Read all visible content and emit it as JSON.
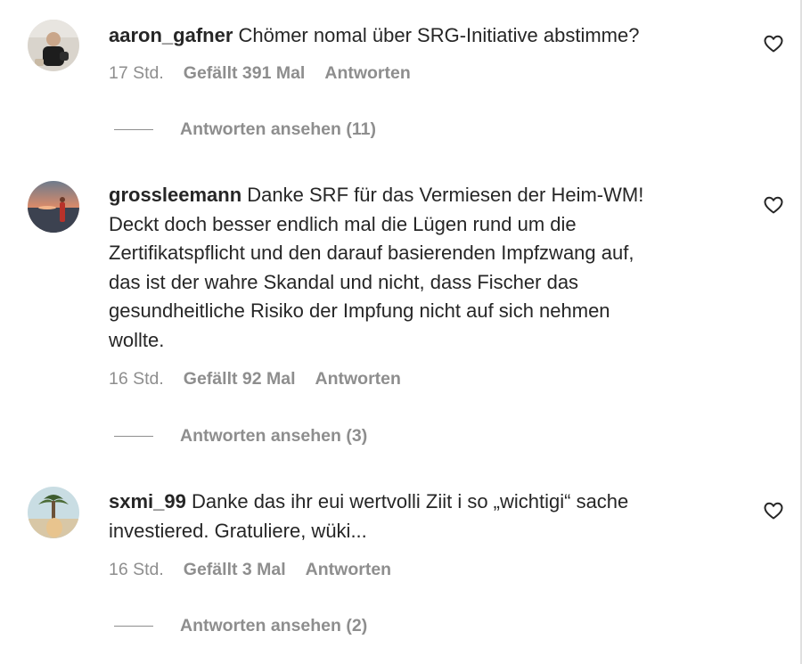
{
  "comments": [
    {
      "username": "aaron_gafner",
      "text": "Chömer nomal über SRG-Initiative abstimme?",
      "time": "17 Std.",
      "likes": "Gefällt 391 Mal",
      "reply": "Antworten",
      "view_replies": "Antworten ansehen (11)",
      "avatar": "avatar-person-dark-shirt"
    },
    {
      "username": "grossleemann",
      "text": "Danke SRF für das Vermiesen der Heim-WM!\nDeckt doch besser endlich mal die Lügen rund um die\nZertifikatspflicht und den darauf basierenden Impfzwang auf,\ndas ist der wahre Skandal und nicht, dass Fischer das\ngesundheitliche Risiko der Impfung nicht auf sich nehmen\nwollte.",
      "time": "16 Std.",
      "likes": "Gefällt 92 Mal",
      "reply": "Antworten",
      "view_replies": "Antworten ansehen (3)",
      "avatar": "avatar-sunset-beach"
    },
    {
      "username": "sxmi_99",
      "text": "Danke das ihr eui wertvolli Ziit i so „wichtigi“ sache\ninvestiered. Gratuliere, wüki...",
      "time": "16 Std.",
      "likes": "Gefällt 3 Mal",
      "reply": "Antworten",
      "view_replies": "Antworten ansehen (2)",
      "avatar": "avatar-palm-tree"
    }
  ],
  "icons": {
    "like": "heart-icon"
  },
  "colors": {
    "text": "#262626",
    "secondary": "#8e8e8e"
  }
}
